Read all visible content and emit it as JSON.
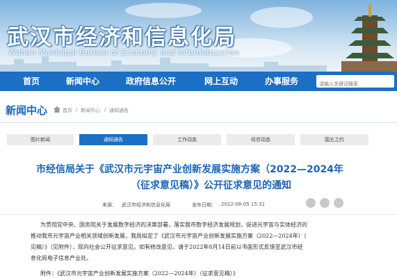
{
  "header": {
    "title": "武汉市经济和信息化局",
    "subtitle": "Wuhan Municipal Bureau of Economy and Informatization"
  },
  "nav": {
    "items": [
      "首页",
      "新闻中心",
      "政府信息公开",
      "网上互动",
      "办事服务"
    ],
    "search_placeholder": "请输入关键词搜索"
  },
  "section": {
    "title": "新闻中心",
    "breadcrumb": [
      "首页",
      "新闻中心",
      "通知通告"
    ],
    "separator": "/"
  },
  "tabs": [
    "图片新闻",
    "通知通告",
    "工作动态",
    "经信动态",
    "国五之约"
  ],
  "active_tab": 1,
  "article": {
    "title_line1": "市经信局关于《武汉市元宇宙产业创新发展实施方案（2022—2024年",
    "title_line2": "（征求意见稿）》公开征求意见的通知",
    "source_label": "来源：",
    "source": "武汉市经济和信息化局",
    "time_label": "发布日期：",
    "time": "2022-08-05 15:31",
    "paragraphs": [
      "为贯彻党中央、国务院关于发展数字经济的决策部署，落实我市数字经济发展规划，促进元宇宙与实体经济的",
      "推动我市元宇宙产业相关领域创新发展，我局拟定了《武汉市元宇宙产业创新发展实施方案（2022—2024年）（",
      "见稿）》（见附件），现向社会公开征求意见。如有修改意见，请于2022年8月14日前以书面形式反馈至武汉市经",
      "息化局电子信息产业处。",
      "附件：《武汉市元宇宙产业创新发展实施方案（2022—2024年）（征求意见稿）》"
    ]
  },
  "colors": {
    "brand": "#1b6fc4",
    "title": "#1b64b6"
  },
  "icons": [
    "home-icon",
    "wechat-icon",
    "weibo-icon",
    "qq-icon"
  ]
}
